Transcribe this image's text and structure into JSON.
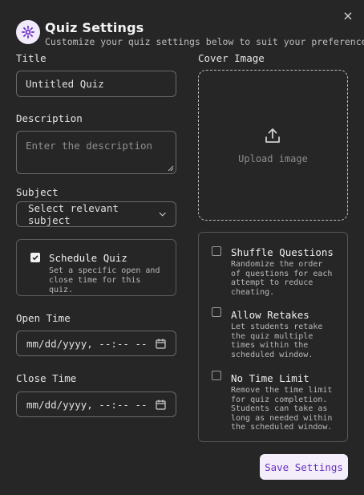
{
  "header": {
    "title": "Quiz Settings",
    "subtitle": "Customize your quiz settings below to suit your preferences.",
    "close_label": "×",
    "icon": "settings-gear-icon",
    "accent": "#6a2fc3"
  },
  "form": {
    "title_label": "Title",
    "title_value": "Untitled Quiz",
    "description_label": "Description",
    "description_placeholder": "Enter the description",
    "subject_label": "Subject",
    "subject_value": "Select relevant subject",
    "schedule": {
      "checked": true,
      "label": "Schedule Quiz",
      "description": "Set a specific open and close time for this quiz."
    },
    "open_time_label": "Open Time",
    "open_time_value": "mm/dd/yyyy, --:-- --",
    "close_time_label": "Close Time",
    "close_time_value": "mm/dd/yyyy, --:-- --"
  },
  "cover": {
    "label": "Cover Image",
    "upload_text": "Upload image"
  },
  "options": [
    {
      "label": "Shuffle Questions",
      "description": "Randomize the order of questions for each attempt to reduce cheating.",
      "checked": false
    },
    {
      "label": "Allow Retakes",
      "description": "Let students retake the quiz multiple times within the scheduled window.",
      "checked": false
    },
    {
      "label": "No Time Limit",
      "description": "Remove the time limit for quiz completion. Students can take as long as needed within the scheduled window.",
      "checked": false
    }
  ],
  "save_label": "Save Settings"
}
